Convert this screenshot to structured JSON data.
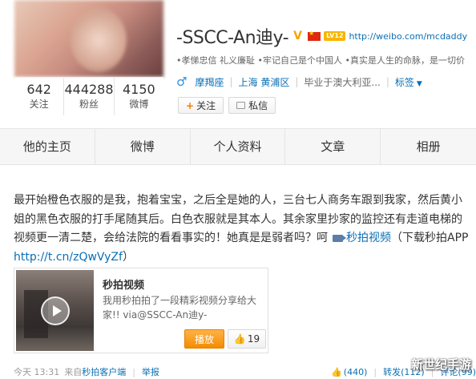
{
  "profile": {
    "stats": [
      {
        "value": "642",
        "label": "关注"
      },
      {
        "value": "444288",
        "label": "粉丝"
      },
      {
        "value": "4150",
        "label": "微博"
      }
    ],
    "name": "-SSCC-An迪y-",
    "verified_badge": "V",
    "vip_badge": "LV12",
    "homepage_url": "http://weibo.com/mcdaddy",
    "bio": "•孝悌忠信 礼义廉耻 •牢记自己是个中国人 •真实是人生的命脉，是一切价",
    "gender_icon": "male-icon",
    "location_link": "摩羯座",
    "district_link": "上海 黄浦区",
    "school_text": "毕业于澳大利亚...",
    "tags_link": "标签",
    "follow_label": "关注",
    "message_label": "私信"
  },
  "tabs": [
    "他的主页",
    "微博",
    "个人资料",
    "文章",
    "相册"
  ],
  "post": {
    "text_before_video": "最开始橙色衣服的是我，抱着宝宝，之后全是她的人，三台七人商务车跟到我家，然后黄小姐的黑色衣服的打手尾随其后。白色衣服就是其本人。其余家里抄家的监控还有走道电梯的视频更一清二楚，会给法院的看看事实的！她真是是弱者吗？呵",
    "video_link_label": "秒拍视频",
    "text_after_video": "（下载秒拍APP",
    "url": "http://t.cn/zQwVyZf",
    "text_end": "）",
    "card": {
      "title": "秒拍视频",
      "description": "我用秒拍拍了一段精彩视频分享给大家!! via@SSCC-An迪y-",
      "play_label": "播放",
      "like_count": "19"
    },
    "footer": {
      "time": "今天 13:31",
      "source_prefix": "来自",
      "source": "秒拍客户端",
      "report": "举报",
      "likes": "(440)",
      "reposts": "转发(112)",
      "comments": "评论(99)"
    }
  },
  "watermark": "新世纪手游",
  "colors": {
    "link": "#0a6fb5",
    "accent_orange": "#f38c00",
    "tab_bg": "#f6f6f6"
  }
}
